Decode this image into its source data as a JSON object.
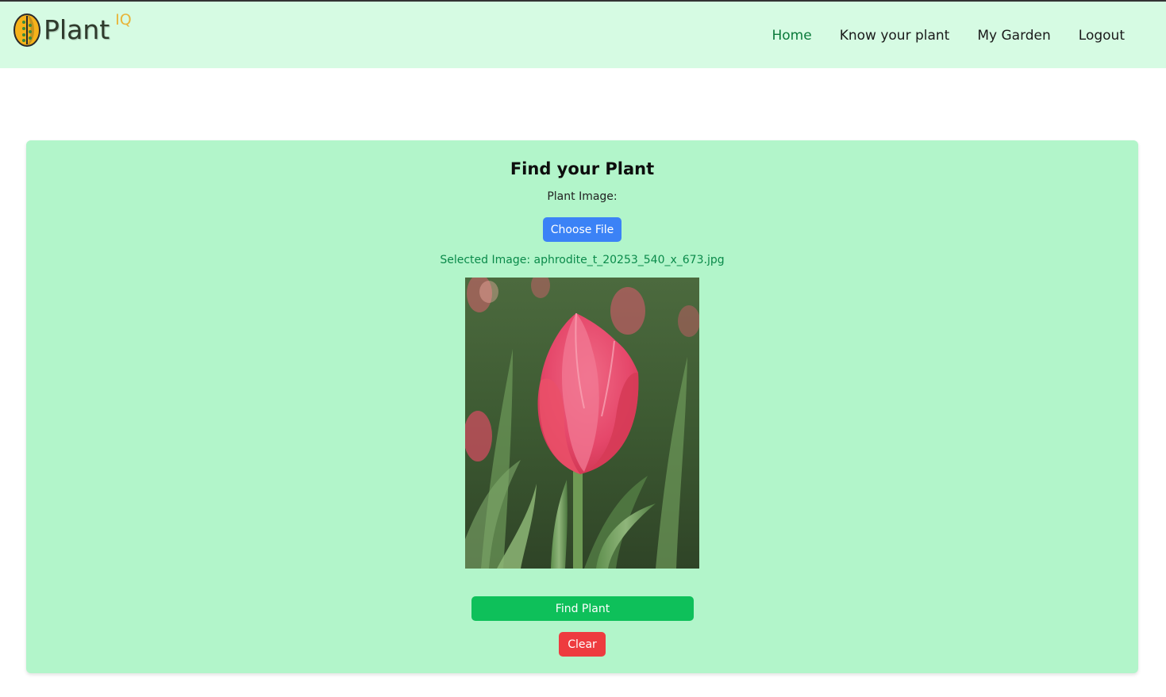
{
  "app": {
    "logo_text": "Plant",
    "logo_sup": "IQ"
  },
  "nav": {
    "items": [
      {
        "label": "Home",
        "active": true
      },
      {
        "label": "Know your plant",
        "active": false
      },
      {
        "label": "My Garden",
        "active": false
      },
      {
        "label": "Logout",
        "active": false
      }
    ]
  },
  "finder": {
    "title": "Find your Plant",
    "image_label": "Plant Image:",
    "choose_file_label": "Choose File",
    "selected_prefix": "Selected Image: ",
    "selected_file": "aphrodite_t_20253_540_x_673.jpg",
    "selected_text": "Selected Image: aphrodite_t_20253_540_x_673.jpg",
    "preview_subject": "pink tulip photo",
    "find_label": "Find Plant",
    "clear_label": "Clear"
  },
  "colors": {
    "header_bg": "#d6fbe3",
    "card_bg": "#b2f5ca",
    "nav_active": "#0a7a3a",
    "choose_button": "#3b82f6",
    "find_button": "#0ec05a",
    "clear_button": "#ee3b3f",
    "selected_text": "#0a8a4a"
  },
  "icons": {
    "logo": "leaf-logo-icon"
  }
}
